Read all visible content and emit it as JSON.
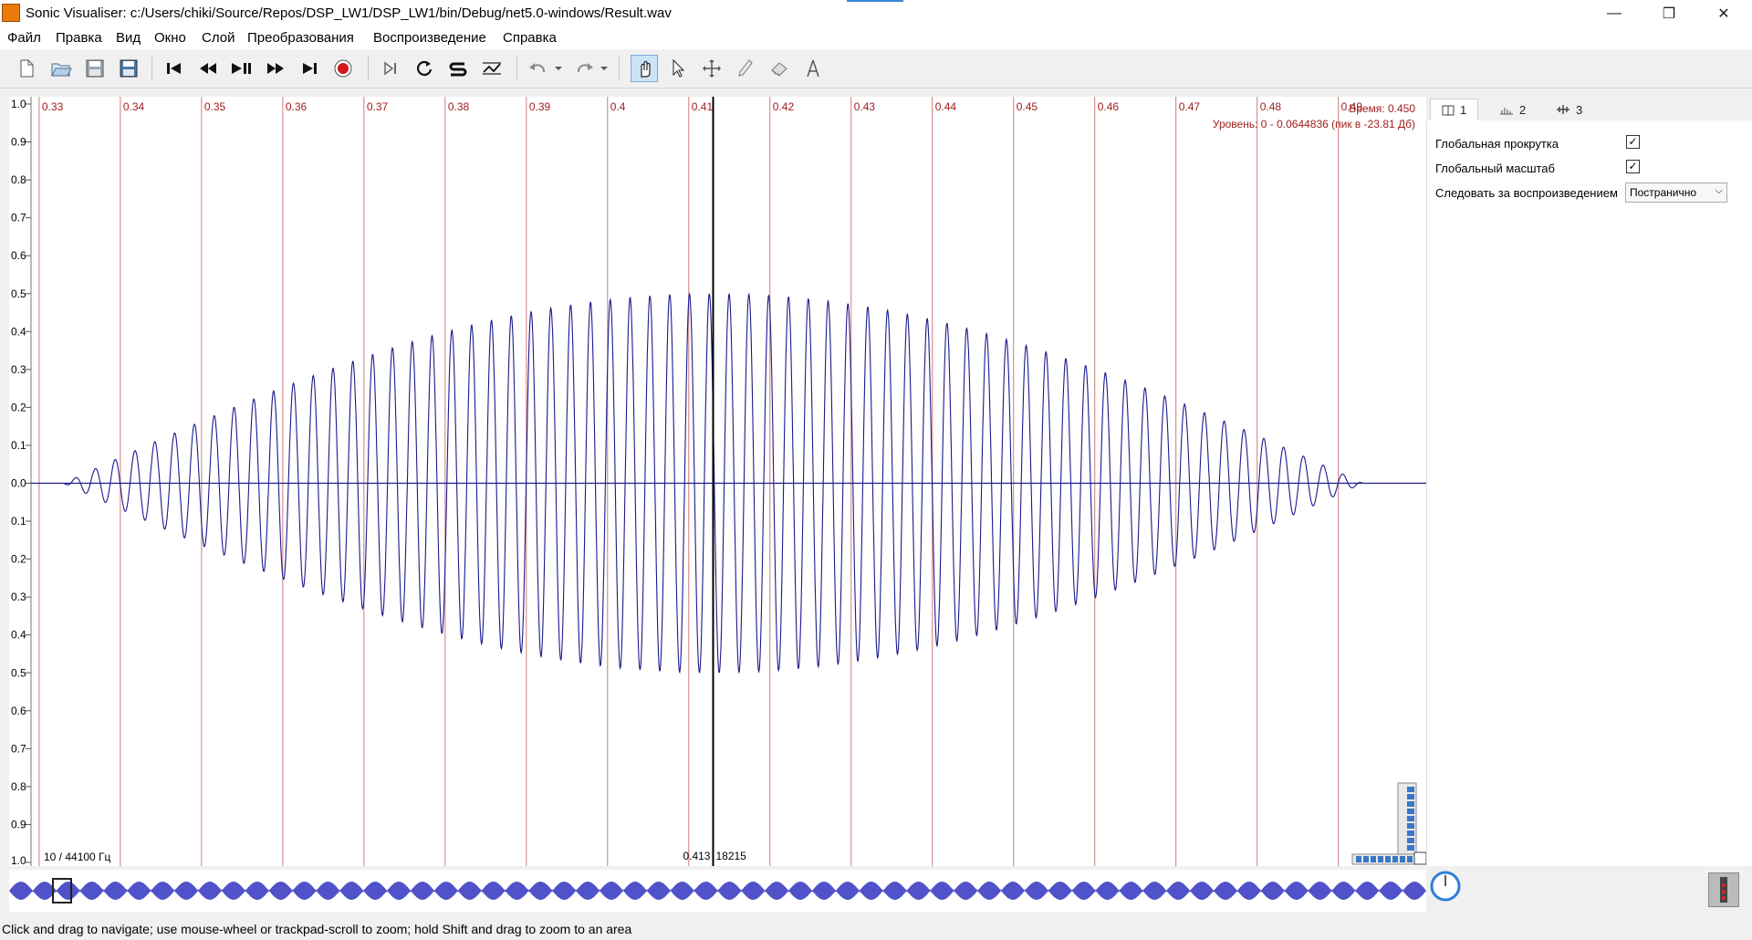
{
  "window": {
    "title": "Sonic Visualiser: c:/Users/chiki/Source/Repos/DSP_LW1/DSP_LW1/bin/Debug/net5.0-windows/Result.wav",
    "min_glyph": "—",
    "max_glyph": "❐",
    "close_glyph": "✕"
  },
  "menu": [
    "Файл",
    "Правка",
    "Вид",
    "Окно",
    "Слой",
    "Преобразования",
    "Воспроизведение",
    "Справка"
  ],
  "pane": {
    "time_readout": "Время: 0.450",
    "level_readout": "Уровень: 0 - 0.0644836 (пик в -23.81 Дб)",
    "zoom_label": "10 / 44100 Гц",
    "cursor_time": "0.413",
    "cursor_frame": "18215",
    "y_ticks": [
      "1.0",
      "0.9",
      "0.8",
      "0.7",
      "0.6",
      "0.5",
      "0.4",
      "0.3",
      "0.2",
      "0.1",
      "0.0",
      "0.1",
      "0.2",
      "0.3",
      "0.4",
      "0.5",
      "0.6",
      "0.7",
      "0.8",
      "0.9",
      "1.0"
    ],
    "x_ticks": [
      "0.33",
      "0.34",
      "0.35",
      "0.36",
      "0.37",
      "0.38",
      "0.39",
      "0.4",
      "0.41",
      "0.42",
      "0.43",
      "0.44",
      "0.45",
      "0.46",
      "0.47",
      "0.48",
      "0.49"
    ],
    "x_range_seconds": [
      0.329,
      0.4997
    ],
    "cursor_seconds": 0.413,
    "waveform_color": "#1a1a8c",
    "grid_color": "#c0504d",
    "label_color": "#a01e1e"
  },
  "tabs": [
    {
      "icon": "layer-icon",
      "label": "1"
    },
    {
      "icon": "waveform-layer-icon",
      "label": "2"
    },
    {
      "icon": "ruler-layer-icon",
      "label": "3"
    }
  ],
  "properties": {
    "global_scroll_label": "Глобальная прокрутка",
    "global_scroll_checked": true,
    "global_zoom_label": "Глобальный масштаб",
    "global_zoom_checked": true,
    "follow_playback_label": "Следовать за воспроизведением",
    "follow_playback_value": "Постранично"
  },
  "check_glyph": "✓",
  "combo_arrow": "⌵",
  "status": "Click and drag to navigate; use mouse-wheel or trackpad-scroll to zoom; hold Shift and drag to zoom to an area",
  "toolbar_icons": [
    "new-file-icon",
    "open-file-icon",
    "save-icon",
    "save-as-icon",
    "rewind-start-icon",
    "rewind-icon",
    "play-pause-icon",
    "fast-forward-icon",
    "fast-forward-end-icon",
    "record-icon",
    "constrain-playback-icon",
    "loop-icon",
    "solo-icon",
    "normalize-icon",
    "undo-icon",
    "redo-icon",
    "navigate-tool-icon",
    "select-tool-icon",
    "edit-tool-icon",
    "draw-tool-icon",
    "erase-tool-icon",
    "measure-tool-icon"
  ]
}
